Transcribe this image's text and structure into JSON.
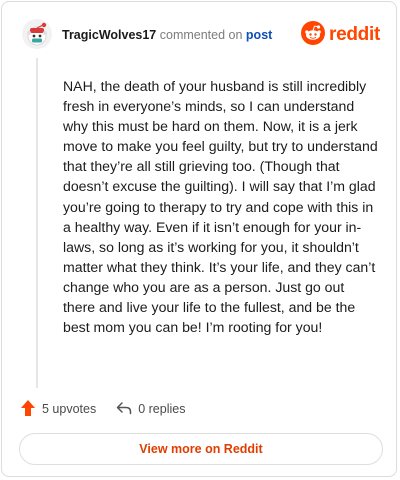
{
  "header": {
    "username": "TragicWolves17",
    "commented_text": "commented on",
    "post_link": "post",
    "brand": "reddit"
  },
  "comment": {
    "text": "NAH, the death of your husband is still incredibly fresh in everyone’s minds, so I can understand why this must be hard on them. Now, it is a jerk move to make you feel guilty, but try to understand that they’re all still grieving too. (Though that doesn’t excuse the guilting). I will say that I’m glad you’re going to therapy to try and cope with this in a healthy way. Even if it isn’t enough for your in-laws, so long as it’s working for you, it shouldn’t matter what they think. It’s your life, and they can’t change who you are as a person. Just go out there and live your life to the fullest, and be the best mom you can be! I’m rooting for you!"
  },
  "actions": {
    "upvotes": "5 upvotes",
    "replies": "0 replies"
  },
  "footer": {
    "view_more": "View more on Reddit"
  },
  "colors": {
    "accent": "#ff4500",
    "link": "#0f4fb8",
    "muted": "#7c7c7c"
  },
  "icons": {
    "avatar": "snoo-avatar-icon",
    "brand": "reddit-logo-icon",
    "upvote": "upvote-arrow-icon",
    "reply": "reply-arrow-icon"
  }
}
